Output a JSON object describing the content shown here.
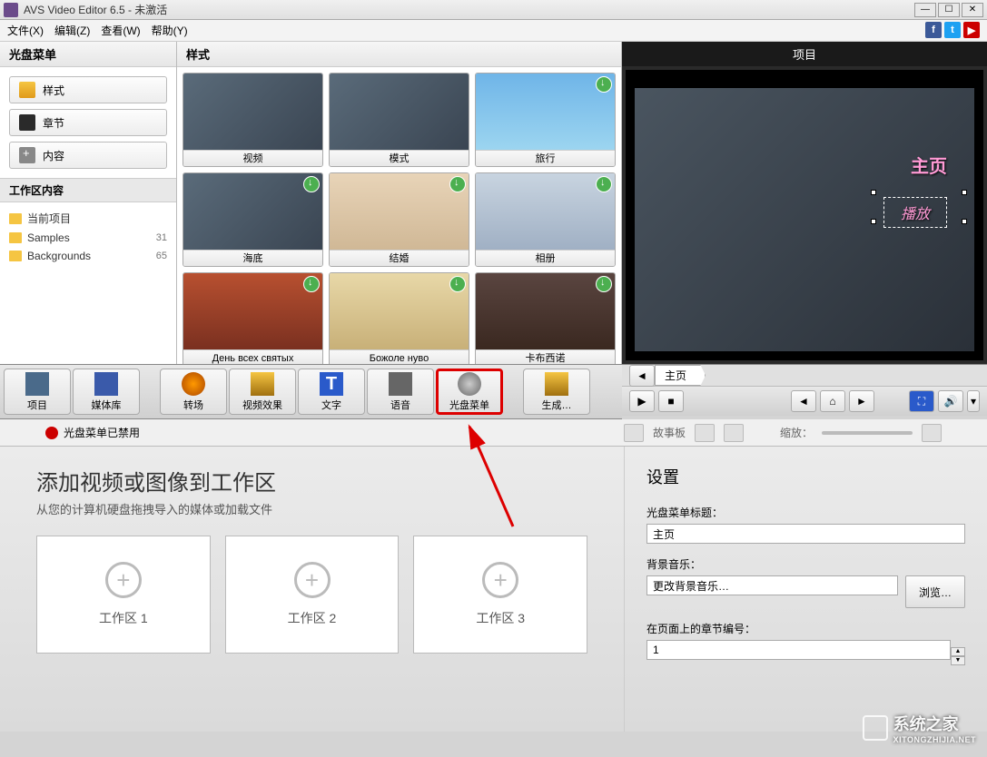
{
  "titlebar": {
    "title": "AVS Video Editor 6.5 - 未激活"
  },
  "menu": {
    "file": "文件(X)",
    "edit": "编辑(Z)",
    "view": "查看(W)",
    "help": "帮助(Y)"
  },
  "leftPanel": {
    "header": "光盘菜单",
    "buttons": {
      "style": "样式",
      "chapter": "章节",
      "content": "内容"
    },
    "workareaHeader": "工作区内容",
    "folders": [
      {
        "name": "当前项目",
        "count": ""
      },
      {
        "name": "Samples",
        "count": "31"
      },
      {
        "name": "Backgrounds",
        "count": "65"
      }
    ]
  },
  "stylePanel": {
    "header": "样式",
    "tiles": [
      {
        "label": "视频"
      },
      {
        "label": "模式"
      },
      {
        "label": "旅行"
      },
      {
        "label": "海底"
      },
      {
        "label": "结婚"
      },
      {
        "label": "相册"
      },
      {
        "label": "День всех святых"
      },
      {
        "label": "Божоле нуво"
      },
      {
        "label": "卡布西诺"
      }
    ]
  },
  "preview": {
    "header": "项目",
    "label1": "主页",
    "label2": "播放"
  },
  "toolbar": {
    "buttons": [
      {
        "label": "项目"
      },
      {
        "label": "媒体库"
      },
      {
        "label": "转场"
      },
      {
        "label": "视频效果"
      },
      {
        "label": "文字"
      },
      {
        "label": "语音"
      },
      {
        "label": "光盘菜单"
      },
      {
        "label": "生成…"
      }
    ],
    "navTab": "主页"
  },
  "lowerHeader": {
    "status": "光盘菜单已禁用",
    "storyboard": "故事板",
    "zoom": "缩放："
  },
  "workArea": {
    "title": "添加视频或图像到工作区",
    "subtitle": "从您的计算机硬盘拖拽导入的媒体或加载文件",
    "boxes": [
      "工作区 1",
      "工作区 2",
      "工作区 3"
    ]
  },
  "settings": {
    "header": "设置",
    "titleLabel": "光盘菜单标题：",
    "titleValue": "主页",
    "musicLabel": "背景音乐：",
    "musicValue": "更改背景音乐…",
    "browse": "浏览…",
    "chapterLabel": "在页面上的章节编号：",
    "chapterValue": "1"
  },
  "watermark": {
    "main": "系统之家",
    "sub": "XITONGZHIJIA.NET"
  }
}
